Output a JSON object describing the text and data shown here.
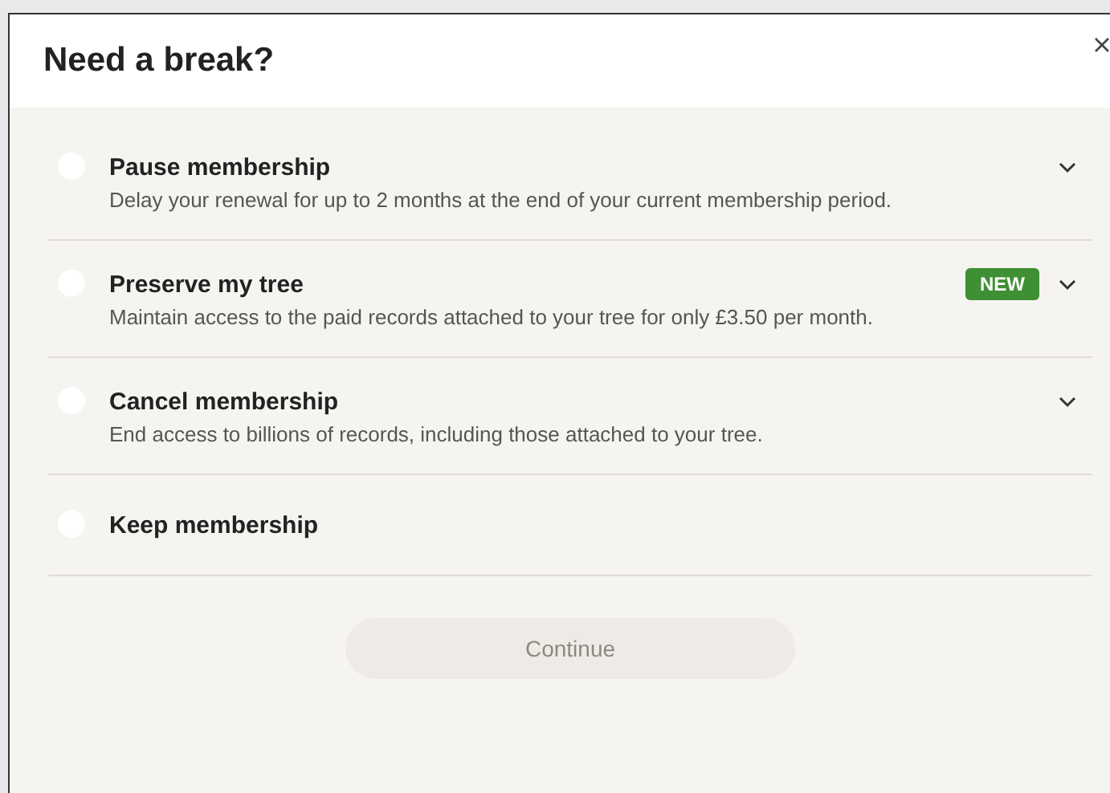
{
  "dialog": {
    "title": "Need a break?",
    "options": [
      {
        "kind": "expandable",
        "title": "Pause membership",
        "description": "Delay your renewal for up to 2 months at the end of your current membership period.",
        "selected": false
      },
      {
        "kind": "expandable",
        "title": "Preserve my tree",
        "badge": "NEW",
        "description": "Maintain access to the paid records attached to your tree for only £3.50 per month.",
        "selected": false
      },
      {
        "kind": "expandable",
        "title": "Cancel membership",
        "description": "End access to billions of records, including those attached to your tree.",
        "selected": false
      },
      {
        "kind": "plain",
        "title": "Keep membership",
        "selected": false
      }
    ],
    "button": {
      "label": "Continue",
      "disabled": true
    }
  }
}
